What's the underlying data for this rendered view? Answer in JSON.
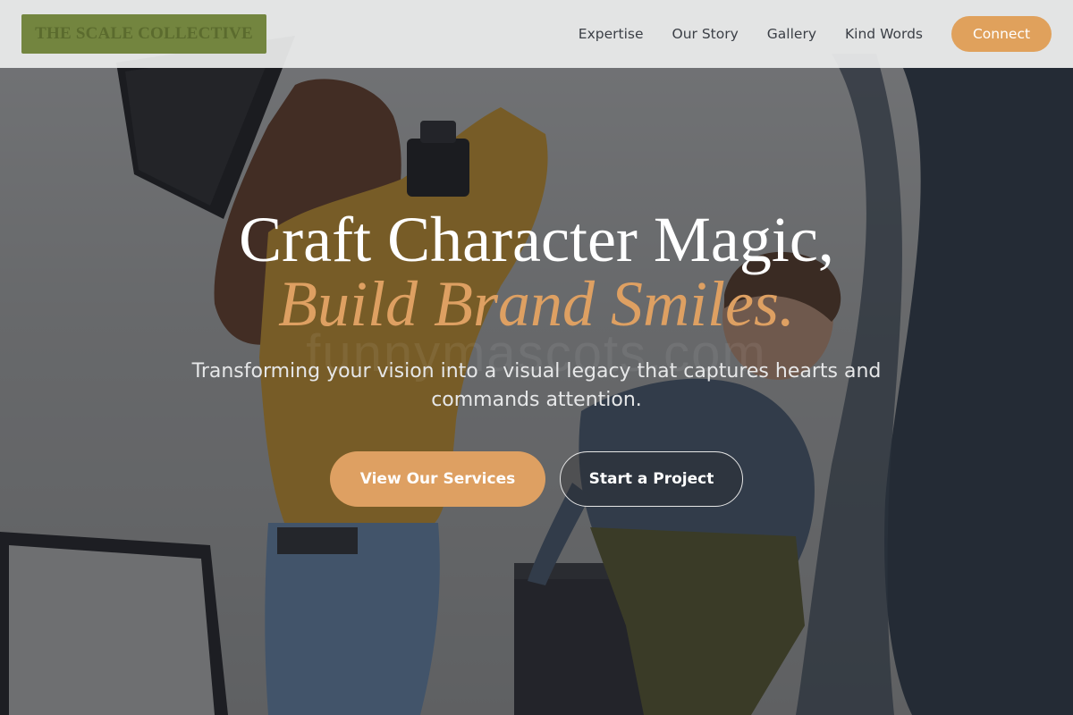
{
  "brand": {
    "name": "THE SCALE COLLECTIVE"
  },
  "nav": {
    "items": [
      "Expertise",
      "Our Story",
      "Gallery",
      "Kind Words"
    ],
    "cta_label": "Connect"
  },
  "hero": {
    "title_line1": "Craft Character Magic,",
    "title_line2": "Build Brand Smiles.",
    "subtitle": "Transforming your vision into a visual legacy that captures hearts and commands attention.",
    "primary_button": "View Our Services",
    "secondary_button": "Start a Project",
    "watermark": "funnymascots.com"
  },
  "colors": {
    "accent": "#dea062",
    "header_bg": "#ecedED",
    "logo_bg": "#73853f",
    "overlay": "#1c1e24"
  }
}
